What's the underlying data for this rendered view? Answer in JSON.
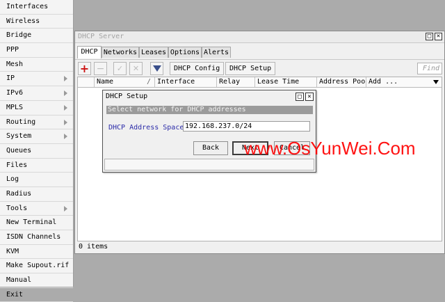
{
  "sidebar": {
    "items": [
      {
        "label": "Interfaces",
        "submenu": false
      },
      {
        "label": "Wireless",
        "submenu": false
      },
      {
        "label": "Bridge",
        "submenu": false
      },
      {
        "label": "PPP",
        "submenu": false
      },
      {
        "label": "Mesh",
        "submenu": false
      },
      {
        "label": "IP",
        "submenu": true
      },
      {
        "label": "IPv6",
        "submenu": true
      },
      {
        "label": "MPLS",
        "submenu": true
      },
      {
        "label": "Routing",
        "submenu": true
      },
      {
        "label": "System",
        "submenu": true
      },
      {
        "label": "Queues",
        "submenu": false
      },
      {
        "label": "Files",
        "submenu": false
      },
      {
        "label": "Log",
        "submenu": false
      },
      {
        "label": "Radius",
        "submenu": false
      },
      {
        "label": "Tools",
        "submenu": true
      },
      {
        "label": "New Terminal",
        "submenu": false
      },
      {
        "label": "ISDN Channels",
        "submenu": false
      },
      {
        "label": "KVM",
        "submenu": false
      },
      {
        "label": "Make Supout.rif",
        "submenu": false
      },
      {
        "label": "Manual",
        "submenu": false
      },
      {
        "label": "Exit",
        "submenu": false
      }
    ]
  },
  "window": {
    "title": "DHCP Server",
    "restore_glyph": "□",
    "close_glyph": "✕",
    "tabs": [
      "DHCP",
      "Networks",
      "Leases",
      "Options",
      "Alerts"
    ],
    "active_tab": "DHCP",
    "toolbar": {
      "add_glyph": "+",
      "remove_glyph": "−",
      "enable_glyph": "✓",
      "disable_glyph": "✕",
      "filter_glyph": "▼",
      "dhcp_config_label": "DHCP Config",
      "dhcp_setup_label": "DHCP Setup",
      "find_placeholder": "Find"
    },
    "columns": [
      "Name",
      "/",
      "Interface",
      "Relay",
      "Lease Time",
      "Address Pool",
      "Add ..."
    ],
    "status_text": "0 items"
  },
  "dialog": {
    "title": "DHCP Setup",
    "step_text": "Select network for DHCP addresses",
    "field_label": "DHCP Address Space:",
    "field_value": "192.168.237.0/24",
    "back_label": "Back",
    "next_label": "Next",
    "cancel_label": "Cancel"
  },
  "watermark": "www.OsYunWei.Com",
  "colors": {
    "accent_red": "#ff0000",
    "label_blue": "#2a2aa8",
    "add_red": "#cc1111"
  }
}
